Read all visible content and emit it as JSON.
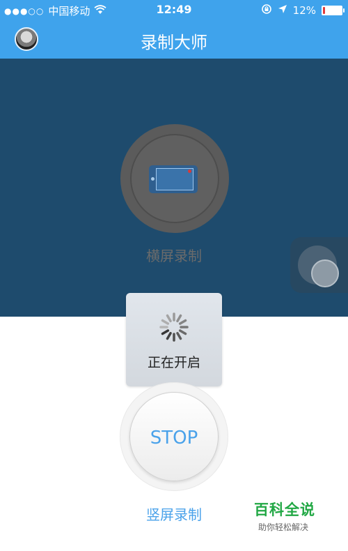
{
  "status_bar": {
    "signal_dots": "●●●○○",
    "carrier": "中国移动",
    "time": "12:49",
    "battery_percent": "12%",
    "battery_level": 0.12,
    "battery_color": "#e23b3b"
  },
  "header": {
    "title": "录制大师",
    "bg_color": "#3fa3ec"
  },
  "landscape": {
    "label": "横屏录制",
    "bg_color": "#1e4b6d"
  },
  "loading_toast": {
    "text": "正在开启"
  },
  "stop_button": {
    "label": "STOP"
  },
  "portrait": {
    "label": "竖屏录制"
  },
  "watermark": {
    "main": "百科全说",
    "sub": "助你轻松解决"
  },
  "icons": {
    "avatar": "user-avatar",
    "wifi": "wifi-icon",
    "lock_rotation": "rotation-lock-icon",
    "location": "location-arrow-icon",
    "battery": "battery-icon",
    "record_landscape": "landscape-phone-icon",
    "assistive": "assistive-touch-icon",
    "spinner": "loading-spinner-icon"
  }
}
